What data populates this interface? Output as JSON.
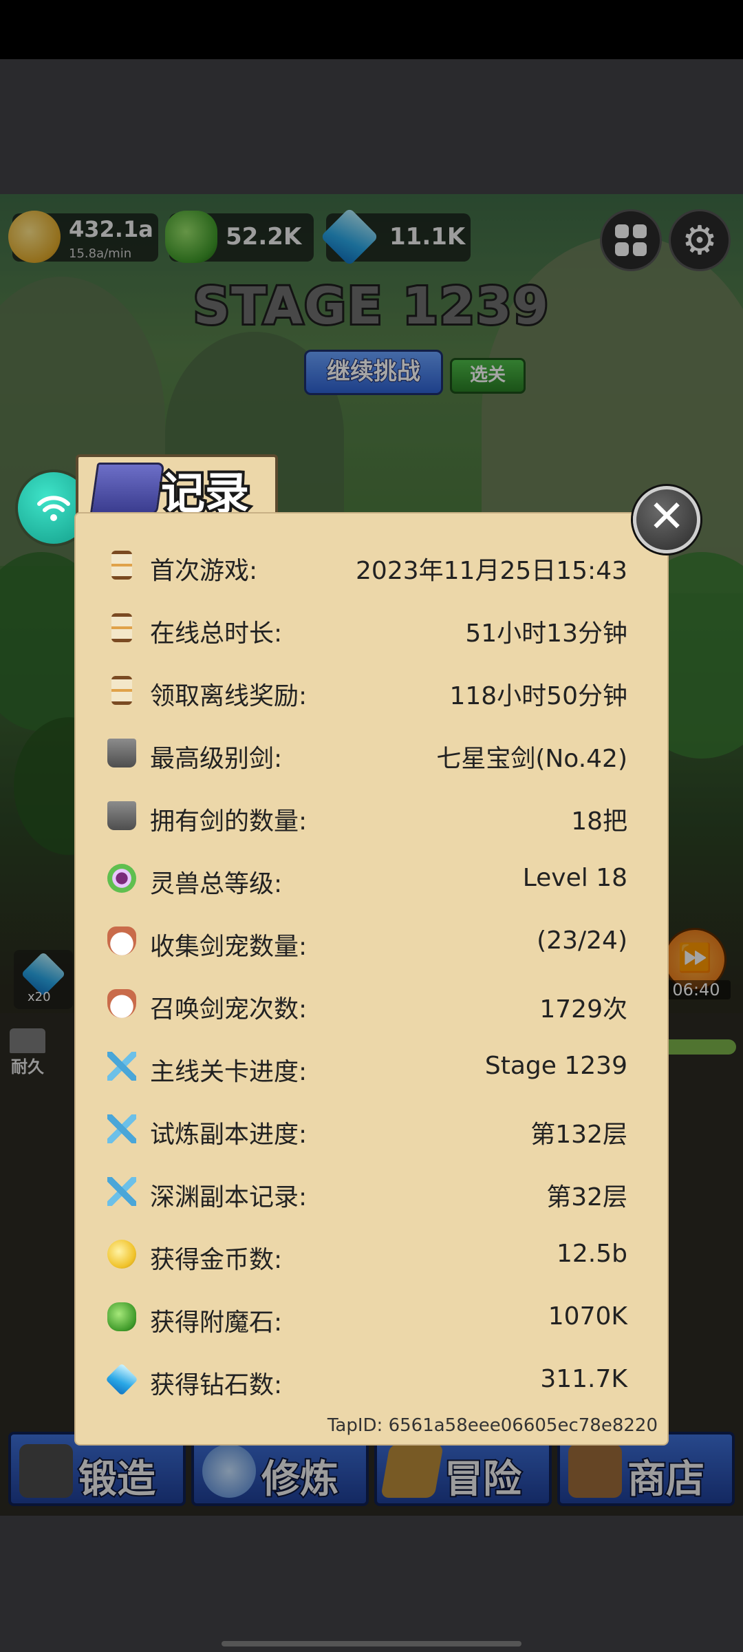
{
  "hud": {
    "gold": "432.1a",
    "gold_rate": "15.8a/min",
    "stones": "52.2K",
    "diamonds": "11.1K"
  },
  "stage": {
    "title": "STAGE 1239",
    "continue_label": "继续挑战",
    "select_label": "选关"
  },
  "side": {
    "gem_count": "x20",
    "durability_label": "耐久",
    "timer": "06:40"
  },
  "record": {
    "title": "记录",
    "close_glyph": "✕",
    "rows": [
      {
        "icon": "hourglass-icon",
        "label": "首次游戏:",
        "value": "2023年11月25日15:43"
      },
      {
        "icon": "hourglass-icon",
        "label": "在线总时长:",
        "value": "51小时13分钟"
      },
      {
        "icon": "hourglass-icon",
        "label": "领取离线奖励:",
        "value": "118小时50分钟"
      },
      {
        "icon": "anvil-icon",
        "label": "最高级别剑:",
        "value": "七星宝剑(No.42)"
      },
      {
        "icon": "anvil-icon",
        "label": "拥有剑的数量:",
        "value": "18把"
      },
      {
        "icon": "spirit-orb-icon",
        "label": "灵兽总等级:",
        "value": "Level 18"
      },
      {
        "icon": "fox-pet-icon",
        "label": "收集剑宠数量:",
        "value": "(23/24)"
      },
      {
        "icon": "fox-pet-icon",
        "label": "召唤剑宠次数:",
        "value": "1729次"
      },
      {
        "icon": "crossed-swords-icon",
        "label": "主线关卡进度:",
        "value": "Stage 1239"
      },
      {
        "icon": "crossed-swords-icon",
        "label": "试炼副本进度:",
        "value": "第132层"
      },
      {
        "icon": "crossed-swords-icon",
        "label": "深渊副本记录:",
        "value": "第32层"
      },
      {
        "icon": "gold-coin-icon",
        "label": "获得金币数:",
        "value": "12.5b"
      },
      {
        "icon": "enchant-stone-icon",
        "label": "获得附魔石:",
        "value": "1070K"
      },
      {
        "icon": "diamond-icon",
        "label": "获得钻石数:",
        "value": "311.7K"
      }
    ],
    "tap_id": "TapID: 6561a58eee06605ec78e8220"
  },
  "menu": {
    "forge": "锻造",
    "train": "修炼",
    "adventure": "冒险",
    "shop": "商店"
  }
}
